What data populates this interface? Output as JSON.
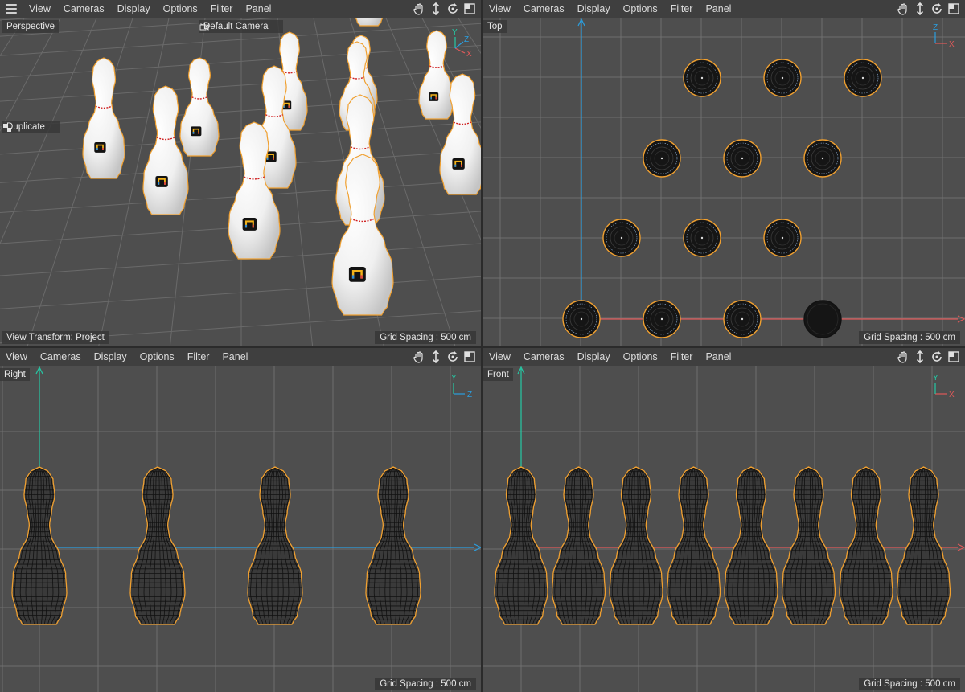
{
  "menu": [
    "View",
    "Cameras",
    "Display",
    "Options",
    "Filter",
    "Panel"
  ],
  "viewports": {
    "perspective": {
      "name": "Perspective",
      "camera": "Default Camera",
      "tool_hint": "Duplicate",
      "view_transform": "View Transform: Project",
      "grid_spacing": "Grid Spacing : 500 cm"
    },
    "top": {
      "name": "Top",
      "grid_spacing": "Grid Spacing : 500 cm"
    },
    "right": {
      "name": "Right",
      "grid_spacing": "Grid Spacing : 500 cm"
    },
    "front": {
      "name": "Front",
      "grid_spacing": "Grid Spacing : 500 cm"
    }
  },
  "axes": {
    "x": "X",
    "y": "Y",
    "z": "Z"
  },
  "icons": {
    "hamburger": "hamburger-menu-icon",
    "pan": "hand-pan-icon",
    "move": "move-arrows-icon",
    "rotate": "rotate-icon",
    "maximize": "maximize-panel-icon",
    "camera": "camera-icon",
    "duplicate": "duplicate-icon"
  },
  "colors": {
    "viewport_bg": "#4e4e4e",
    "menubar_bg": "#3f3f3f",
    "grid": "#6f6f6f",
    "selection": "#f0a030",
    "axis_x": "#e05a5a",
    "axis_y": "#25c9a5",
    "axis_z": "#2b9fe0"
  }
}
